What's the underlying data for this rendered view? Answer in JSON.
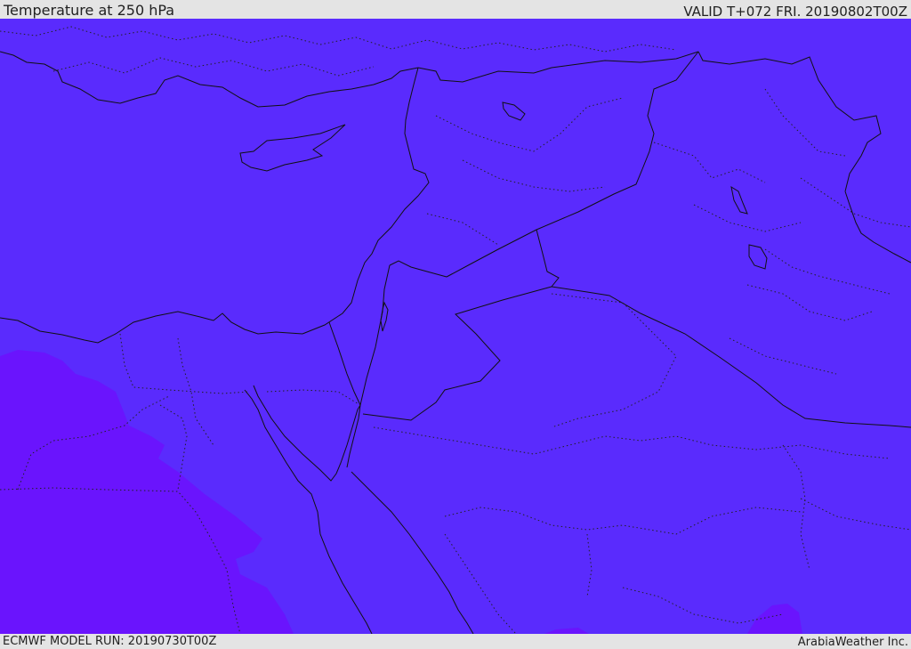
{
  "header": {
    "title": "Temperature at 250 hPa",
    "valid": "VALID T+072 FRI. 20190802T00Z"
  },
  "footer": {
    "model_run": "ECMWF MODEL RUN: 20190730T00Z",
    "credit": "ArabiaWeather Inc."
  },
  "colors": {
    "field_main": "#5a2bfd",
    "field_cold": "#6a14fd",
    "lines": "#111111",
    "frame": "#e4e4e4"
  }
}
